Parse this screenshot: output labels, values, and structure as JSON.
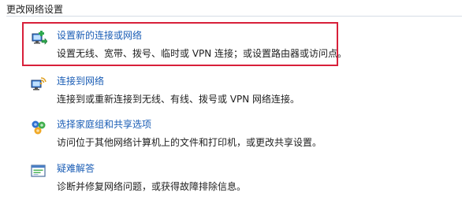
{
  "section": {
    "header": "更改网络设置"
  },
  "tasks": [
    {
      "title": "设置新的连接或网络",
      "description": "设置无线、宽带、拨号、临时或 VPN 连接；或设置路由器或访问点。",
      "icon": "network-setup-icon"
    },
    {
      "title": "连接到网络",
      "description": "连接到或重新连接到无线、有线、拨号或 VPN 网络连接。",
      "icon": "connect-network-icon"
    },
    {
      "title": "选择家庭组和共享选项",
      "description": "访问位于其他网络计算机上的文件和打印机，或更改共享设置。",
      "icon": "homegroup-icon"
    },
    {
      "title": "疑难解答",
      "description": "诊断并修复网络问题，或获得故障排除信息。",
      "icon": "troubleshoot-icon"
    }
  ],
  "colors": {
    "link": "#1a5db5",
    "highlight": "#d8203a",
    "rule": "#d6dde6"
  }
}
